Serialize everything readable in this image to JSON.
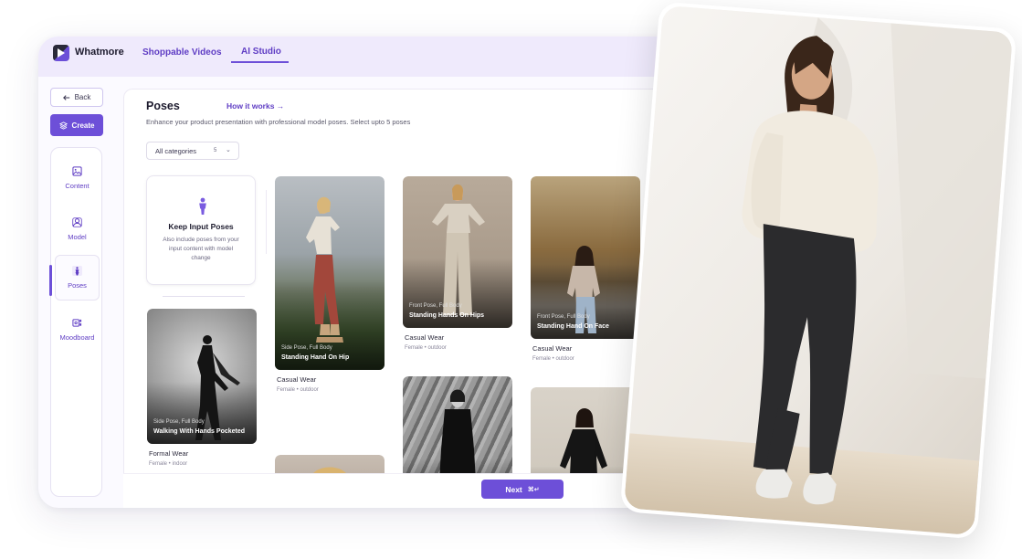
{
  "app": {
    "brand": "Whatmore"
  },
  "nav": {
    "tabs": [
      "Shoppable Videos",
      "AI Studio"
    ]
  },
  "sidebar": {
    "back_label": "Back",
    "create_label": "Create",
    "items": [
      "Content",
      "Model",
      "Poses",
      "Moodboard"
    ]
  },
  "page": {
    "title": "Poses",
    "how_link": "How it works →",
    "subtitle": "Enhance your product presentation with professional model poses. Select upto 5 poses",
    "category_select": {
      "value": "All categories",
      "count": "5"
    }
  },
  "keep_card": {
    "title": "Keep Input Poses",
    "description": "Also include poses from your input content with model change"
  },
  "poses": [
    {
      "type": "Side Pose, Full Body",
      "name": "Walking With Hands Pocketed",
      "category": "Formal Wear",
      "tags": "Female • indoor"
    },
    {
      "type": "Side Pose, Full Body",
      "name": "Standing Hand On Hip",
      "category": "Casual Wear",
      "tags": "Female • outdoor"
    },
    {
      "type": "Front Pose, Full Body",
      "name": "Standing Hands On Hips",
      "category": "Casual Wear",
      "tags": "Female • outdoor"
    },
    {
      "type": "Front Pose, Full Body",
      "name": "Standing Hand On Face",
      "category": "Casual Wear",
      "tags": "Female • outdoor"
    }
  ],
  "footer": {
    "next_label": "Next",
    "shortcut": "⌘↵"
  },
  "colors": {
    "accent": "#6d4fd8",
    "accent_text": "#5f3dc4",
    "topbar": "#efeafc"
  }
}
